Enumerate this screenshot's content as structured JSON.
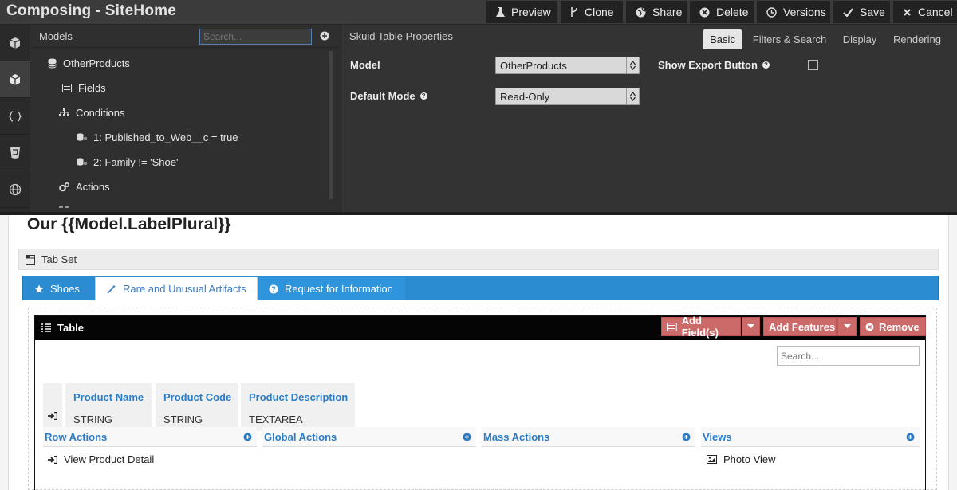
{
  "app": {
    "title": "Composing - SiteHome"
  },
  "toolbar": {
    "preview": "Preview",
    "clone": "Clone",
    "share": "Share",
    "delete": "Delete",
    "versions": "Versions",
    "save": "Save",
    "cancel": "Cancel"
  },
  "rail": {
    "icons": [
      "cube-icon",
      "cubes-icon",
      "code-braces-icon",
      "css3-icon",
      "globe-icon"
    ],
    "active_index": 1
  },
  "models_panel": {
    "title": "Models",
    "search_placeholder": "Search...",
    "tree": {
      "model": "OtherProducts",
      "fields": "Fields",
      "conditions": "Conditions",
      "condition_1": "1: Published_to_Web__c = true",
      "condition_2": "2: Family != 'Shoe'",
      "actions": "Actions"
    }
  },
  "properties": {
    "title": "Skuid Table Properties",
    "tabs": [
      "Basic",
      "Filters & Search",
      "Display",
      "Rendering"
    ],
    "active_tab": "Basic",
    "model_label": "Model",
    "model_value": "OtherProducts",
    "default_mode_label": "Default Mode",
    "default_mode_value": "Read-Only",
    "show_export_label": "Show Export Button",
    "show_export_checked": false
  },
  "canvas": {
    "heading": "Our {{Model.LabelPlural}}",
    "tabset_label": "Tab Set",
    "tabs": [
      "Shoes",
      "Rare and Unusual Artifacts",
      "Request for Information"
    ],
    "active_tab": "Rare and Unusual Artifacts",
    "table": {
      "label": "Table",
      "add_fields": "Add Field(s)",
      "add_features": "Add Features",
      "remove": "Remove",
      "search_placeholder": "Search...",
      "columns": [
        {
          "name": "Product Name",
          "type": "STRING"
        },
        {
          "name": "Product Code",
          "type": "STRING"
        },
        {
          "name": "Product Description",
          "type": "TEXTAREA"
        }
      ],
      "sections": [
        {
          "title": "Row Actions",
          "item": "View Product Detail"
        },
        {
          "title": "Global Actions",
          "item": ""
        },
        {
          "title": "Mass Actions",
          "item": ""
        },
        {
          "title": "Views",
          "item": "Photo View"
        }
      ]
    }
  },
  "colors": {
    "accent_blue": "#2b8cd1",
    "danger_red": "#cc6a6a",
    "dark_chrome": "#2e2e2e"
  }
}
